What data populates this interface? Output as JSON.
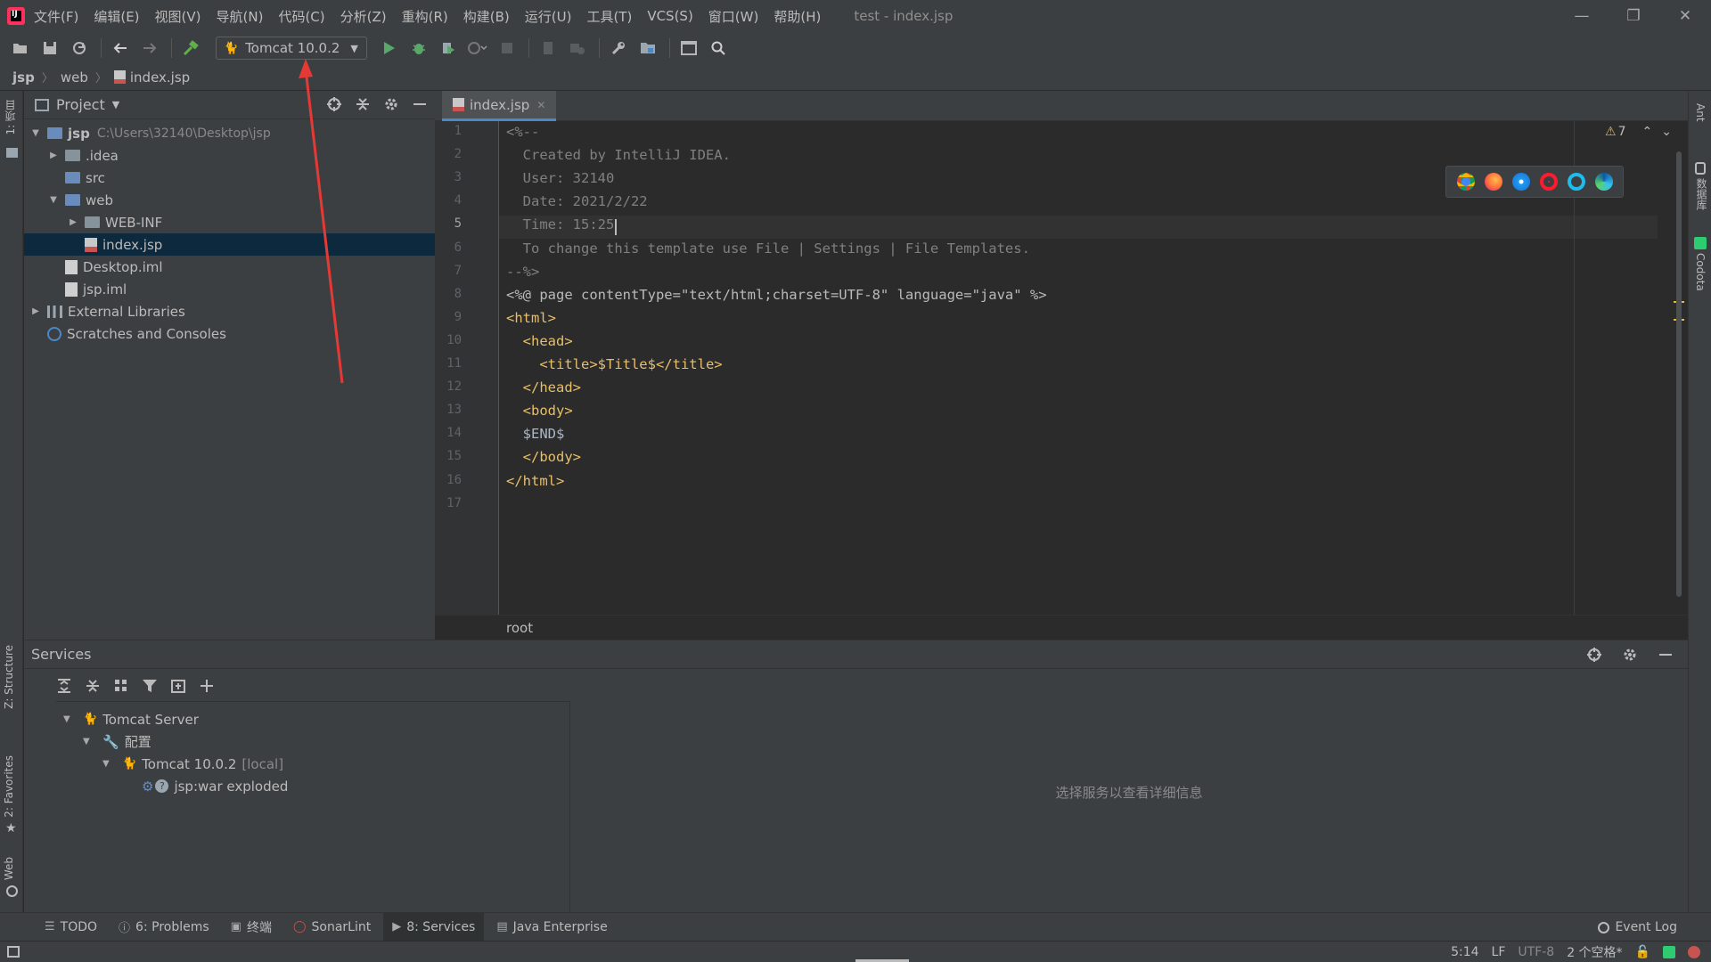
{
  "menubar": {
    "items": [
      "文件(F)",
      "编辑(E)",
      "视图(V)",
      "导航(N)",
      "代码(C)",
      "分析(Z)",
      "重构(R)",
      "构建(B)",
      "运行(U)",
      "工具(T)",
      "VCS(S)",
      "窗口(W)",
      "帮助(H)"
    ],
    "window_title": "test - index.jsp",
    "controls": {
      "minimize": "—",
      "restore": "❐",
      "close": "✕"
    }
  },
  "toolbar": {
    "run_config": "Tomcat 10.0.2",
    "icons": [
      "open-icon",
      "save-icon",
      "sync-icon",
      "back-icon",
      "forward-icon",
      "build-icon",
      "run-icon",
      "debug-icon",
      "coverage-icon",
      "profile-icon",
      "stop-icon",
      "device-icon",
      "attach-icon",
      "settings-wrench-icon",
      "project-structure-icon",
      "terminal-icon",
      "search-icon"
    ]
  },
  "breadcrumb": [
    "jsp",
    "web",
    "index.jsp"
  ],
  "project": {
    "title": "Project",
    "tree": [
      {
        "label": "jsp",
        "hint": "C:\\Users\\32140\\Desktop\\jsp",
        "arrow": "down",
        "type": "folder-blue"
      },
      {
        "label": ".idea",
        "arrow": "right",
        "type": "folder"
      },
      {
        "label": "src",
        "arrow": "",
        "type": "folder-blue"
      },
      {
        "label": "web",
        "arrow": "down",
        "type": "folder-blue"
      },
      {
        "label": "WEB-INF",
        "arrow": "right",
        "type": "folder"
      },
      {
        "label": "index.jsp",
        "arrow": "",
        "type": "jsp"
      },
      {
        "label": "Desktop.iml",
        "arrow": "",
        "type": "file"
      },
      {
        "label": "jsp.iml",
        "arrow": "",
        "type": "file"
      },
      {
        "label": "External Libraries",
        "arrow": "right",
        "type": "libs"
      },
      {
        "label": "Scratches and Consoles",
        "arrow": "",
        "type": "scratch"
      }
    ]
  },
  "editor": {
    "tab": "index.jsp",
    "warnings": "7",
    "current_line": 5,
    "line_numbers": [
      "1",
      "2",
      "3",
      "4",
      "5",
      "6",
      "7",
      "8",
      "9",
      "10",
      "11",
      "12",
      "13",
      "14",
      "15",
      "16",
      "17"
    ],
    "lines": [
      "<%--",
      "  Created by IntelliJ IDEA.",
      "  User: 32140",
      "  Date: 2021/2/22",
      "  Time: 15:25",
      "  To change this template use File | Settings | File Templates.",
      "--%>",
      "<%@ page contentType=\"text/html;charset=UTF-8\" language=\"java\" %>",
      "<html>",
      "  <head>",
      "    <title>$Title$</title>",
      "  </head>",
      "  <body>",
      "  $END$",
      "  </body>",
      "</html>",
      ""
    ],
    "status": "root",
    "browsers": [
      "chrome-icon",
      "firefox-icon",
      "safari-icon",
      "opera-icon",
      "ie-icon",
      "edge-icon"
    ]
  },
  "left_strip": {
    "project_tab": "1: 项目",
    "structure_tab": "Z: Structure",
    "favorites_tab": "2: Favorites",
    "web_tab": "Web"
  },
  "right_strip": {
    "ant_tab": "Ant",
    "database_tab": "数据库",
    "codota_tab": "Codota"
  },
  "services": {
    "title": "Services",
    "tree": [
      {
        "label": "Tomcat Server",
        "arrow": "down"
      },
      {
        "label": "配置",
        "arrow": "down"
      },
      {
        "label": "Tomcat 10.0.2",
        "suffix": "[local]",
        "arrow": "down"
      },
      {
        "label": "jsp:war exploded",
        "arrow": ""
      }
    ],
    "detail_placeholder": "选择服务以查看详细信息"
  },
  "bottom_tabs": [
    {
      "label": "TODO",
      "icon": "list-icon"
    },
    {
      "label": "6: Problems",
      "icon": "problems-icon"
    },
    {
      "label": "终端",
      "icon": "terminal-icon"
    },
    {
      "label": "SonarLint",
      "icon": "sonarlint-icon"
    },
    {
      "label": "8: Services",
      "icon": "services-icon",
      "active": true
    },
    {
      "label": "Java Enterprise",
      "icon": "java-enterprise-icon"
    }
  ],
  "event_log": "Event Log",
  "statusbar": {
    "position": "5:14",
    "line_sep": "LF",
    "encoding": "UTF-8",
    "indent": "2 个空格*"
  },
  "colors": {
    "accent": "#4a88c7",
    "selection": "#0d293e",
    "annotation_arrow": "#e53935"
  }
}
